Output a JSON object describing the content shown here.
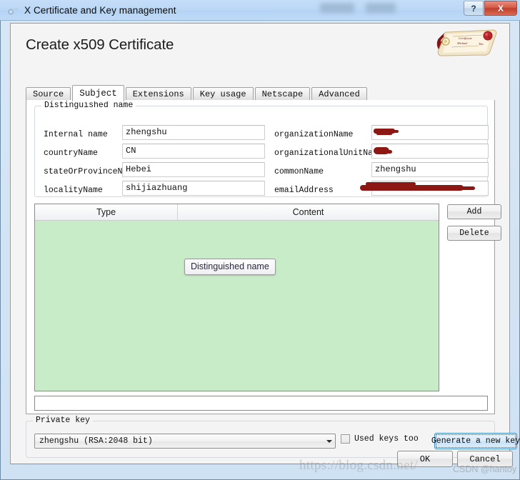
{
  "window": {
    "title": "X Certificate and Key management",
    "icon": "key-icon",
    "help_label": "?",
    "close_label": "X"
  },
  "dialog": {
    "headline": "Create x509 Certificate",
    "logo": "certificate-scroll-icon"
  },
  "tabs": [
    {
      "label": "Source",
      "active": false
    },
    {
      "label": "Subject",
      "active": true
    },
    {
      "label": "Extensions",
      "active": false
    },
    {
      "label": "Key usage",
      "active": false
    },
    {
      "label": "Netscape",
      "active": false
    },
    {
      "label": "Advanced",
      "active": false
    }
  ],
  "distinguished_name": {
    "group_title": "Distinguished name",
    "fields_left": [
      {
        "label": "Internal name",
        "value": "zhengshu"
      },
      {
        "label": "countryName",
        "value": "CN"
      },
      {
        "label": "stateOrProvinceName",
        "value": "Hebei"
      },
      {
        "label": "localityName",
        "value": "shijiazhuang"
      }
    ],
    "fields_right": [
      {
        "label": "organizationName",
        "value": "",
        "redacted": true
      },
      {
        "label": "organizationalUnitName",
        "value": "",
        "redacted": true
      },
      {
        "label": "commonName",
        "value": "zhengshu",
        "redacted": false
      },
      {
        "label": "emailAddress",
        "value": "",
        "redacted": true
      }
    ],
    "redaction_color": "#8c1713"
  },
  "table": {
    "columns": [
      "Type",
      "Content"
    ],
    "rows": [],
    "empty_body_color": "#c8ebc8",
    "tooltip": "Distinguished name"
  },
  "table_buttons": {
    "add": "Add",
    "delete": "Delete"
  },
  "extra_input": {
    "value": "",
    "placeholder": ""
  },
  "private_key": {
    "group_title": "Private key",
    "selected": "zhengshu (RSA:2048 bit)",
    "options": [
      "zhengshu (RSA:2048 bit)"
    ],
    "used_keys_too_label": "Used keys too",
    "used_keys_too_checked": false,
    "generate_label": "Generate a new key",
    "generate_focused": true
  },
  "footer": {
    "ok": "OK",
    "cancel": "Cancel"
  },
  "watermark": {
    "url": "https://blog.csdn.net/",
    "handle": "CSDN @hantoy"
  },
  "colors": {
    "titlebar": "#bcd8f6",
    "close_button": "#d55a46",
    "table_green": "#c8ebc8",
    "focus_blue": "#3c8cc8",
    "redaction": "#8c1713"
  }
}
